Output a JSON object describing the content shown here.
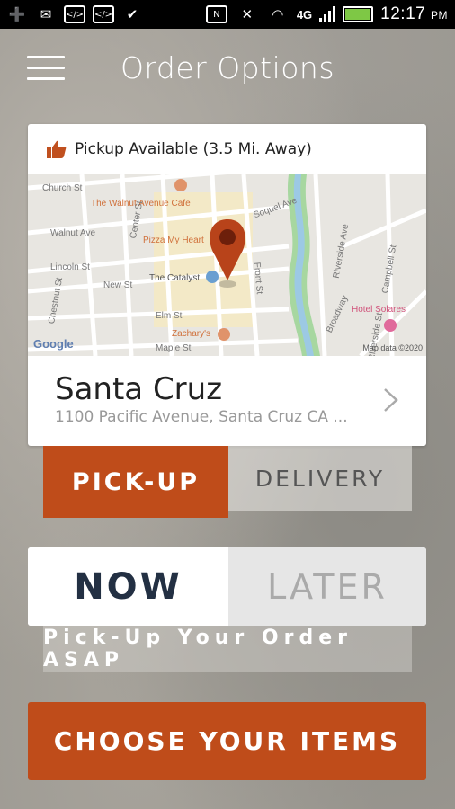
{
  "status_bar": {
    "time": "12:17",
    "ampm": "PM",
    "network": "4G",
    "icons": [
      "add-icon",
      "gmail-icon",
      "code-icon",
      "code-icon",
      "messenger-icon",
      "nfc-icon",
      "mute-icon",
      "wifi-icon",
      "signal-icon",
      "battery-icon"
    ]
  },
  "header": {
    "title": "Order Options",
    "menu_icon": "hamburger-menu-icon"
  },
  "location_card": {
    "availability_text": "Pickup Available (3.5 Mi. Away)",
    "availability_icon": "thumbs-up-icon",
    "store_name": "Santa Cruz",
    "store_address": "1100 Pacific Avenue, Santa Cruz CA ...",
    "map": {
      "labels": {
        "church": "Church St",
        "walnut": "The Walnut Avenue Cafe",
        "walnut_ave": "Walnut Ave",
        "center": "Center St",
        "pizza": "Pizza My Heart",
        "lincoln": "Lincoln St",
        "catalyst": "The Catalyst",
        "new_st": "New St",
        "chestnut": "Chestnut St",
        "elm": "Elm St",
        "zacharys": "Zachary's",
        "maple": "Maple St",
        "front": "Front St",
        "soquel": "Soquel Ave",
        "riverside": "Riverside Ave",
        "broadway": "Broadway",
        "hotel": "Hotel Solares",
        "campbell": "Campbell St",
        "riverside_st": "Riverside St",
        "google": "Google",
        "map_data": "Map data ©2020"
      }
    }
  },
  "fulfillment_tabs": {
    "pickup": "PICK-UP",
    "delivery": "DELIVERY",
    "selected": "pickup"
  },
  "timing_tabs": {
    "now": "NOW",
    "later": "LATER",
    "selected": "now"
  },
  "timing_hint": "Pick-Up Your Order ASAP",
  "cta": {
    "label": "CHOOSE YOUR ITEMS"
  },
  "colors": {
    "accent": "#bf4c1a",
    "dark_text": "#233043"
  }
}
